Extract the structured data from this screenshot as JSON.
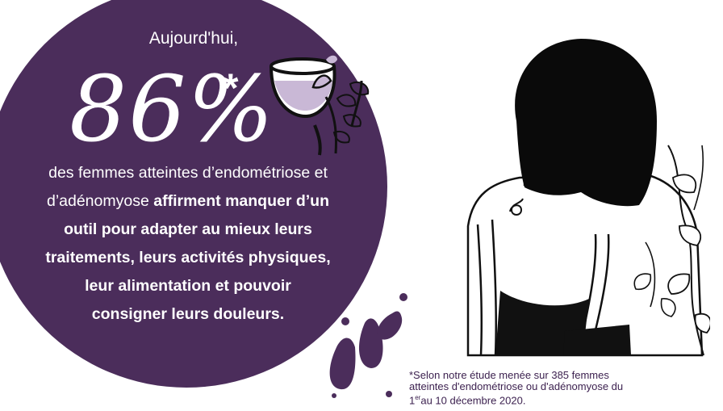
{
  "stat": {
    "intro": "Aujourd'hui,",
    "value": "86%",
    "asterisk": "*",
    "line1": "des femmes atteintes d’endométriose et",
    "line2_regular": "d’adénomyose",
    "line2_bold": "affirment manquer d’un",
    "line3": "outil pour adapter au mieux leurs",
    "line4": "traitements, leurs activités physiques,",
    "line5": "leur alimentation et pouvoir",
    "line6": "consigner leurs douleurs."
  },
  "footnote": {
    "line1": "*Selon notre étude menée sur 385 femmes",
    "line2": "atteintes d'endométriose ou d'adénomyose du",
    "line3_pre": "1",
    "line3_sup": "er",
    "line3_post": "au 10 décembre 2020."
  },
  "colors": {
    "circle": "#4b2d5b",
    "accent_light": "#c9b8d6",
    "ink": "#111111",
    "footnote_text": "#3d2250"
  }
}
